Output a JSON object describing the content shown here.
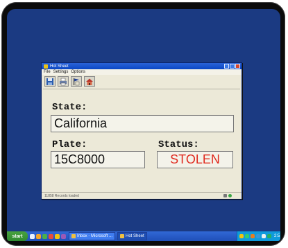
{
  "window": {
    "title": "Hot Sheet"
  },
  "menu": [
    "File",
    "Settings",
    "Options"
  ],
  "toolbar": [
    "save-icon",
    "print-icon",
    "flag-icon",
    "house-icon"
  ],
  "fields": {
    "state_label": "State:",
    "state_value": "California",
    "plate_label": "Plate:",
    "plate_value": "15C8000",
    "status_label": "Status:",
    "status_value": "STOLEN"
  },
  "statusbar": {
    "text": "11858 Records loaded"
  },
  "taskbar": {
    "start_label": "start",
    "tasks": [
      "Inbox - Microsoft ...",
      "Hot Sheet"
    ],
    "clock": "2:5"
  },
  "colors": {
    "desktop": "#1b3a82",
    "status_red": "#e02a1f"
  }
}
